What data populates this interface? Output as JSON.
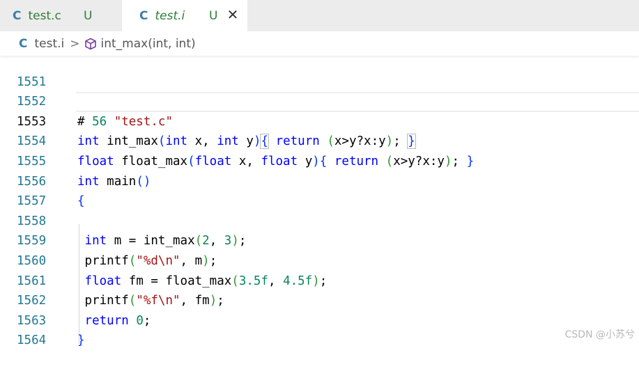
{
  "tabs": [
    {
      "icon": "C",
      "name": "test.c",
      "status": "U"
    },
    {
      "icon": "C",
      "name": "test.i",
      "status": "U",
      "close": "✕"
    }
  ],
  "breadcrumb": {
    "file": "test.i",
    "separator": ">",
    "symbol": "int_max(int, int)"
  },
  "editor": {
    "lines": [
      {
        "n": "1551",
        "text": ""
      },
      {
        "n": "1552",
        "text": "# 56 \"test.c\""
      },
      {
        "n": "1553",
        "text": "int int_max(int x, int y){ return (x>y?x:y); }"
      },
      {
        "n": "1554",
        "text": "float float_max(float x, float y){ return (x>y?x:y); }"
      },
      {
        "n": "1555",
        "text": "int main()"
      },
      {
        "n": "1556",
        "text": "{"
      },
      {
        "n": "1557",
        "text": ""
      },
      {
        "n": "1558",
        "text": " int m = int_max(2, 3);"
      },
      {
        "n": "1559",
        "text": " printf(\"%d\\n\", m);"
      },
      {
        "n": "1560",
        "text": " float fm = float_max(3.5f, 4.5f);"
      },
      {
        "n": "1561",
        "text": " printf(\"%f\\n\", fm);"
      },
      {
        "n": "1562",
        "text": " return 0;"
      },
      {
        "n": "1563",
        "text": "}"
      },
      {
        "n": "1564",
        "text": ""
      }
    ]
  },
  "watermark": "CSDN @小苏兮",
  "colors": {
    "keyword": "#0000ff",
    "number": "#098658",
    "string": "#a31515",
    "line_number": "#237893",
    "tab_filename": "#2e7d3a"
  }
}
